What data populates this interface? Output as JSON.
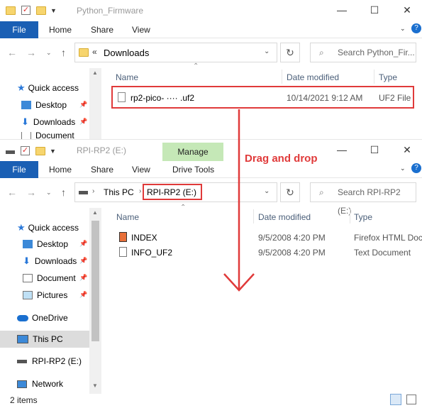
{
  "top_window": {
    "title": "Python_Firmware",
    "ribbon": {
      "file": "File",
      "home": "Home",
      "share": "Share",
      "view": "View"
    },
    "address": {
      "prefix": "«",
      "path": "Downloads"
    },
    "search_placeholder": "Search Python_Fir...",
    "columns": {
      "name": "Name",
      "date": "Date modified",
      "type": "Type"
    },
    "files": [
      {
        "name": "rp2-pico- ···· .uf2",
        "date": "10/14/2021 9:12 AM",
        "type": "UF2 File"
      }
    ],
    "sidebar": [
      {
        "label": "Quick access"
      },
      {
        "label": "Desktop"
      },
      {
        "label": "Downloads"
      },
      {
        "label": "Document"
      }
    ]
  },
  "bottom_window": {
    "title": "RPI-RP2 (E:)",
    "manage_tab": "Manage",
    "drive_tools_tab": "Drive Tools",
    "ribbon": {
      "file": "File",
      "home": "Home",
      "share": "Share",
      "view": "View"
    },
    "address": {
      "seg1": "This PC",
      "seg2": "RPI-RP2 (E:)"
    },
    "search_placeholder": "Search RPI-RP2 (E:)",
    "columns": {
      "name": "Name",
      "date": "Date modified",
      "type": "Type"
    },
    "files": [
      {
        "name": "INDEX",
        "date": "9/5/2008 4:20 PM",
        "type": "Firefox HTML Doc"
      },
      {
        "name": "INFO_UF2",
        "date": "9/5/2008 4:20 PM",
        "type": "Text Document"
      }
    ],
    "sidebar": [
      {
        "label": "Quick access"
      },
      {
        "label": "Desktop"
      },
      {
        "label": "Downloads"
      },
      {
        "label": "Document"
      },
      {
        "label": "Pictures"
      },
      {
        "label": "OneDrive"
      },
      {
        "label": "This PC"
      },
      {
        "label": "RPI-RP2 (E:)"
      },
      {
        "label": "Network"
      }
    ],
    "status": "2 items"
  },
  "annotation": {
    "text": "Drag and drop",
    "color": "#e03a3a"
  },
  "colors": {
    "accent": "#1a5fb4",
    "manage_tab": "#c5e8b7",
    "highlight": "#e03a3a",
    "selected": "#dcdcdc"
  }
}
